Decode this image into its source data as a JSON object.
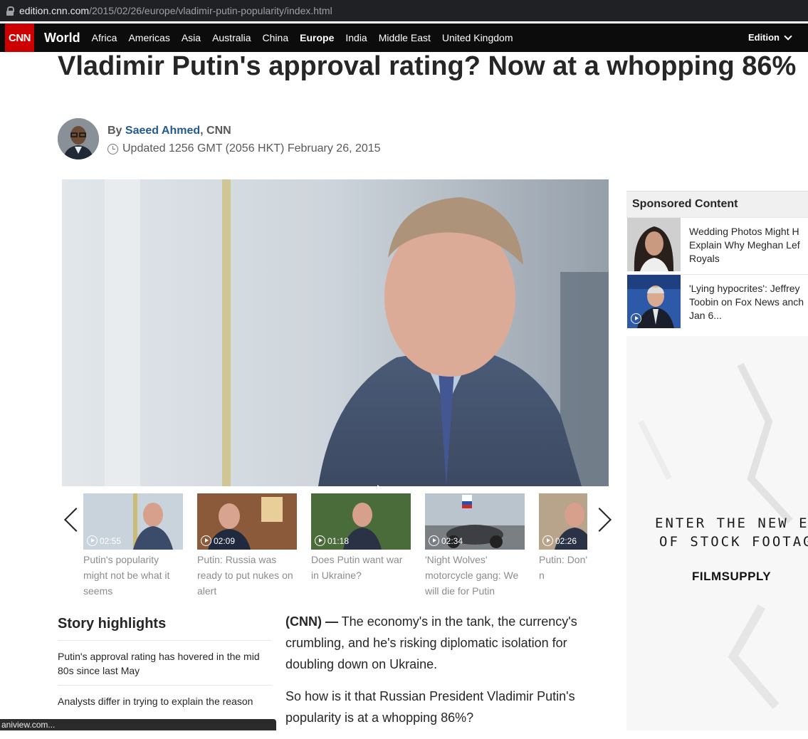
{
  "browser": {
    "url_host": "edition.cnn.com",
    "url_path": "/2015/02/26/europe/vladimir-putin-popularity/index.html",
    "status_text": "aniview.com..."
  },
  "nav": {
    "logo": "CNN",
    "section": "World",
    "items": [
      "Africa",
      "Americas",
      "Asia",
      "Australia",
      "China",
      "Europe",
      "India",
      "Middle East",
      "United Kingdom"
    ],
    "active_item": "Europe",
    "edition_label": "Edition"
  },
  "article": {
    "headline": "Vladimir Putin's approval rating? Now at a whopping 86%",
    "byline_prefix": "By",
    "author": "Saeed Ahmed",
    "byline_suffix": ", CNN",
    "updated": "Updated 1256 GMT (2056 HKT) February 26, 2015"
  },
  "videos": [
    {
      "duration": "02:55",
      "caption": "Putin's popularity might not be what it seems"
    },
    {
      "duration": "02:09",
      "caption": "Putin: Russia was ready to put nukes on alert"
    },
    {
      "duration": "01:18",
      "caption": "Does Putin want war in Ukraine?"
    },
    {
      "duration": "02:34",
      "caption": "'Night Wolves' motorcycle gang: We will die for Putin"
    },
    {
      "duration": "02:26",
      "caption": "Putin: Don't us, we're n"
    }
  ],
  "highlights": {
    "title": "Story highlights",
    "items": [
      "Putin's approval rating has hovered in the mid 80s since last May",
      "Analysts differ in trying to explain the reason"
    ]
  },
  "body": {
    "dateline": "(CNN) —",
    "p1": " The economy's in the tank, the currency's crumbling, and he's risking diplomatic isolation for doubling down on Ukraine.",
    "p2": "So how is it that Russian President Vladimir Putin's popularity is at a whopping 86%?"
  },
  "sponsored": {
    "title": "Sponsored Content",
    "items": [
      {
        "text_lines": [
          "Wedding Photos Might H",
          "Explain Why Meghan Lef",
          "Royals"
        ]
      },
      {
        "text_lines": [
          "'Lying hypocrites': Jeffrey",
          "Toobin on Fox News anch",
          "Jan 6..."
        ]
      }
    ]
  },
  "ad": {
    "line1": "ENTER THE NEW ERA",
    "line2": "OF STOCK FOOTAGE",
    "brand": "FILMSUPPLY"
  },
  "colors": {
    "cnn_red": "#cc0000",
    "nav_bg": "#0c0c0c",
    "author_link": "#245b8f"
  }
}
